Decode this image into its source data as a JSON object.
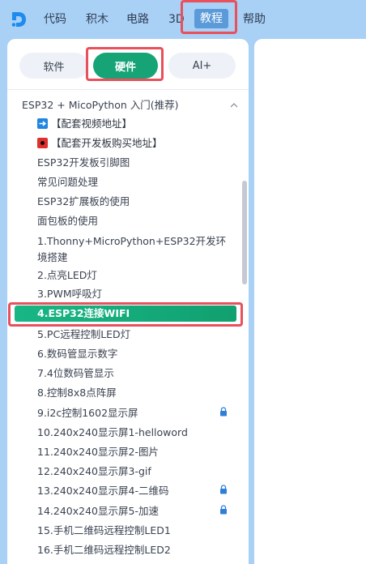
{
  "nav": {
    "items": [
      "代码",
      "积木",
      "电路",
      "3D",
      "教程",
      "帮助"
    ],
    "active": "教程"
  },
  "tabs": [
    "软件",
    "硬件",
    "AI+"
  ],
  "active_tab": "硬件",
  "section": {
    "title": "ESP32 + MicoPython 入门(推荐)",
    "expanded": true
  },
  "items": [
    {
      "label": "【配套视频地址】",
      "icon": "arrow-right-icon",
      "icon_color": "#2186e0"
    },
    {
      "label": "【配套开发板购买地址】",
      "icon": "red-square-icon",
      "icon_color": "#e0302c"
    },
    {
      "label": "ESP32开发板引脚图"
    },
    {
      "label": "常见问题处理"
    },
    {
      "label": "ESP32扩展板的使用"
    },
    {
      "label": "面包板的使用"
    },
    {
      "label": "1.Thonny+MicroPython+ESP32开发环境搭建"
    },
    {
      "label": "2.点亮LED灯"
    },
    {
      "label": "3.PWM呼吸灯"
    },
    {
      "label": "4.ESP32连接WIFI",
      "active": true
    },
    {
      "label": "5.PC远程控制LED灯"
    },
    {
      "label": "6.数码管显示数字"
    },
    {
      "label": "7.4位数码管显示"
    },
    {
      "label": "8.控制8x8点阵屏"
    },
    {
      "label": "9.i2c控制1602显示屏",
      "locked": true
    },
    {
      "label": "10.240x240显示屏1-helloword"
    },
    {
      "label": "11.240x240显示屏2-图片"
    },
    {
      "label": "12.240x240显示屏3-gif"
    },
    {
      "label": "13.240x240显示屏4-二维码",
      "locked": true
    },
    {
      "label": "14.240x240显示屏5-加速",
      "locked": true
    },
    {
      "label": "15.手机二维码远程控制LED1"
    },
    {
      "label": "16.手机二维码远程控制LED2"
    }
  ],
  "colors": {
    "accent": "#16a477",
    "nav_active": "#5a9ad8",
    "highlight": "#e8505b",
    "lock": "#2f7fd8",
    "background": "#a9d0f5"
  }
}
